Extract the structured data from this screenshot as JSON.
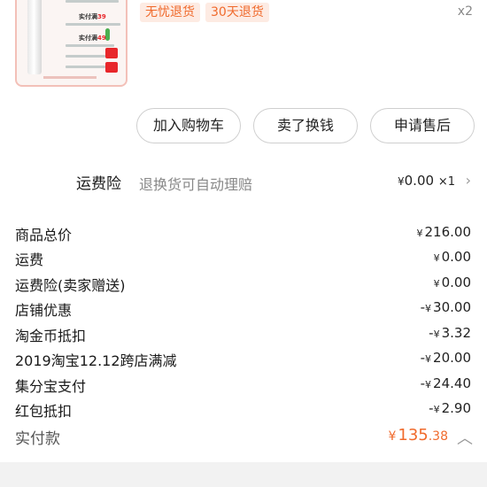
{
  "product": {
    "badges": [
      "无忧退货",
      "30天退货"
    ],
    "quantity": "x2"
  },
  "actions": {
    "add_to_cart": "加入购物车",
    "sell_resell": "卖了换钱",
    "after_sale": "申请售后"
  },
  "insurance": {
    "title": "运费险",
    "description": "退换货可自动理赔",
    "currency": "¥",
    "price": "0.00",
    "count": "×1"
  },
  "breakdown": [
    {
      "label": "商品总价",
      "currency": "¥",
      "value": "216.00",
      "prefix": ""
    },
    {
      "label": "运费",
      "currency": "¥",
      "value": "0.00",
      "prefix": ""
    },
    {
      "label": "运费险(卖家赠送)",
      "currency": "¥",
      "value": "0.00",
      "prefix": ""
    },
    {
      "label": "店铺优惠",
      "currency": "¥",
      "value": "30.00",
      "prefix": "-"
    },
    {
      "label": "淘金币抵扣",
      "currency": "¥",
      "value": "3.32",
      "prefix": "-"
    },
    {
      "label": "2019淘宝12.12跨店满减",
      "currency": "¥",
      "value": "20.00",
      "prefix": "-"
    },
    {
      "label": "集分宝支付",
      "currency": "¥",
      "value": "24.40",
      "prefix": "-"
    },
    {
      "label": "红包抵扣",
      "currency": "¥",
      "value": "2.90",
      "prefix": "-"
    }
  ],
  "total": {
    "label": "实付款",
    "currency": "¥",
    "value_int": "135",
    "value_dec": ".38"
  },
  "colors": {
    "accent": "#f06a2c",
    "badge_bg": "#fdebe3"
  }
}
